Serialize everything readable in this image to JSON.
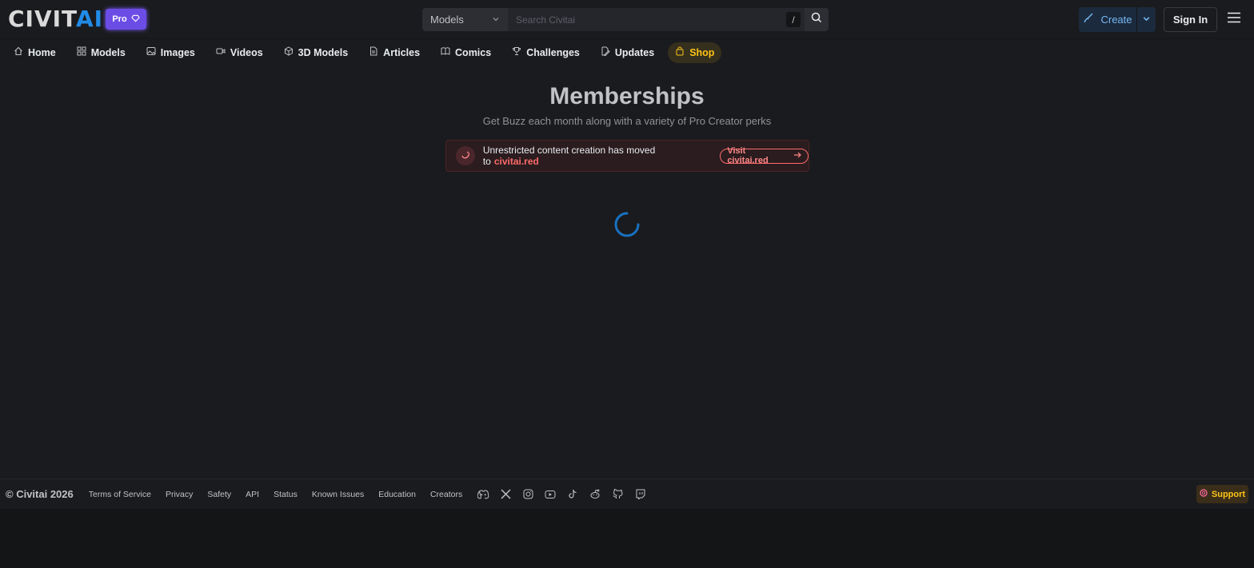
{
  "header": {
    "logo_civit": "CIVIT",
    "logo_ai": "AI",
    "pro_label": "Pro",
    "search": {
      "category": "Models",
      "placeholder": "Search Civitai",
      "shortcut": "/"
    },
    "create_label": "Create",
    "signin_label": "Sign In"
  },
  "nav": {
    "items": [
      {
        "label": "Home",
        "icon": "home-icon"
      },
      {
        "label": "Models",
        "icon": "grid-icon"
      },
      {
        "label": "Images",
        "icon": "photo-icon"
      },
      {
        "label": "Videos",
        "icon": "video-icon"
      },
      {
        "label": "3D Models",
        "icon": "cube-icon"
      },
      {
        "label": "Articles",
        "icon": "file-text-icon"
      },
      {
        "label": "Comics",
        "icon": "book-icon"
      },
      {
        "label": "Challenges",
        "icon": "trophy-icon"
      },
      {
        "label": "Updates",
        "icon": "file-pencil-icon"
      },
      {
        "label": "Shop",
        "icon": "shopping-bag-icon"
      }
    ]
  },
  "main": {
    "title": "Memberships",
    "subtitle": "Get Buzz each month along with a variety of Pro Creator perks",
    "alert": {
      "text": "Unrestricted content creation has moved to",
      "highlight": "civitai.red",
      "link_label": "Visit civitai.red"
    }
  },
  "footer": {
    "copyright": "© Civitai 2026",
    "links": [
      "Terms of Service",
      "Privacy",
      "Safety",
      "API",
      "Status",
      "Known Issues",
      "Education",
      "Creators"
    ],
    "social_icons": [
      "discord-icon",
      "x-icon",
      "instagram-icon",
      "youtube-icon",
      "tiktok-icon",
      "reddit-icon",
      "github-icon",
      "twitch-icon"
    ],
    "support_label": "Support"
  },
  "colors": {
    "accent_blue": "#228be6",
    "pro_purple": "#6b4de6",
    "alert_red": "#ff6b6b",
    "shop_yellow": "#fcc419"
  }
}
